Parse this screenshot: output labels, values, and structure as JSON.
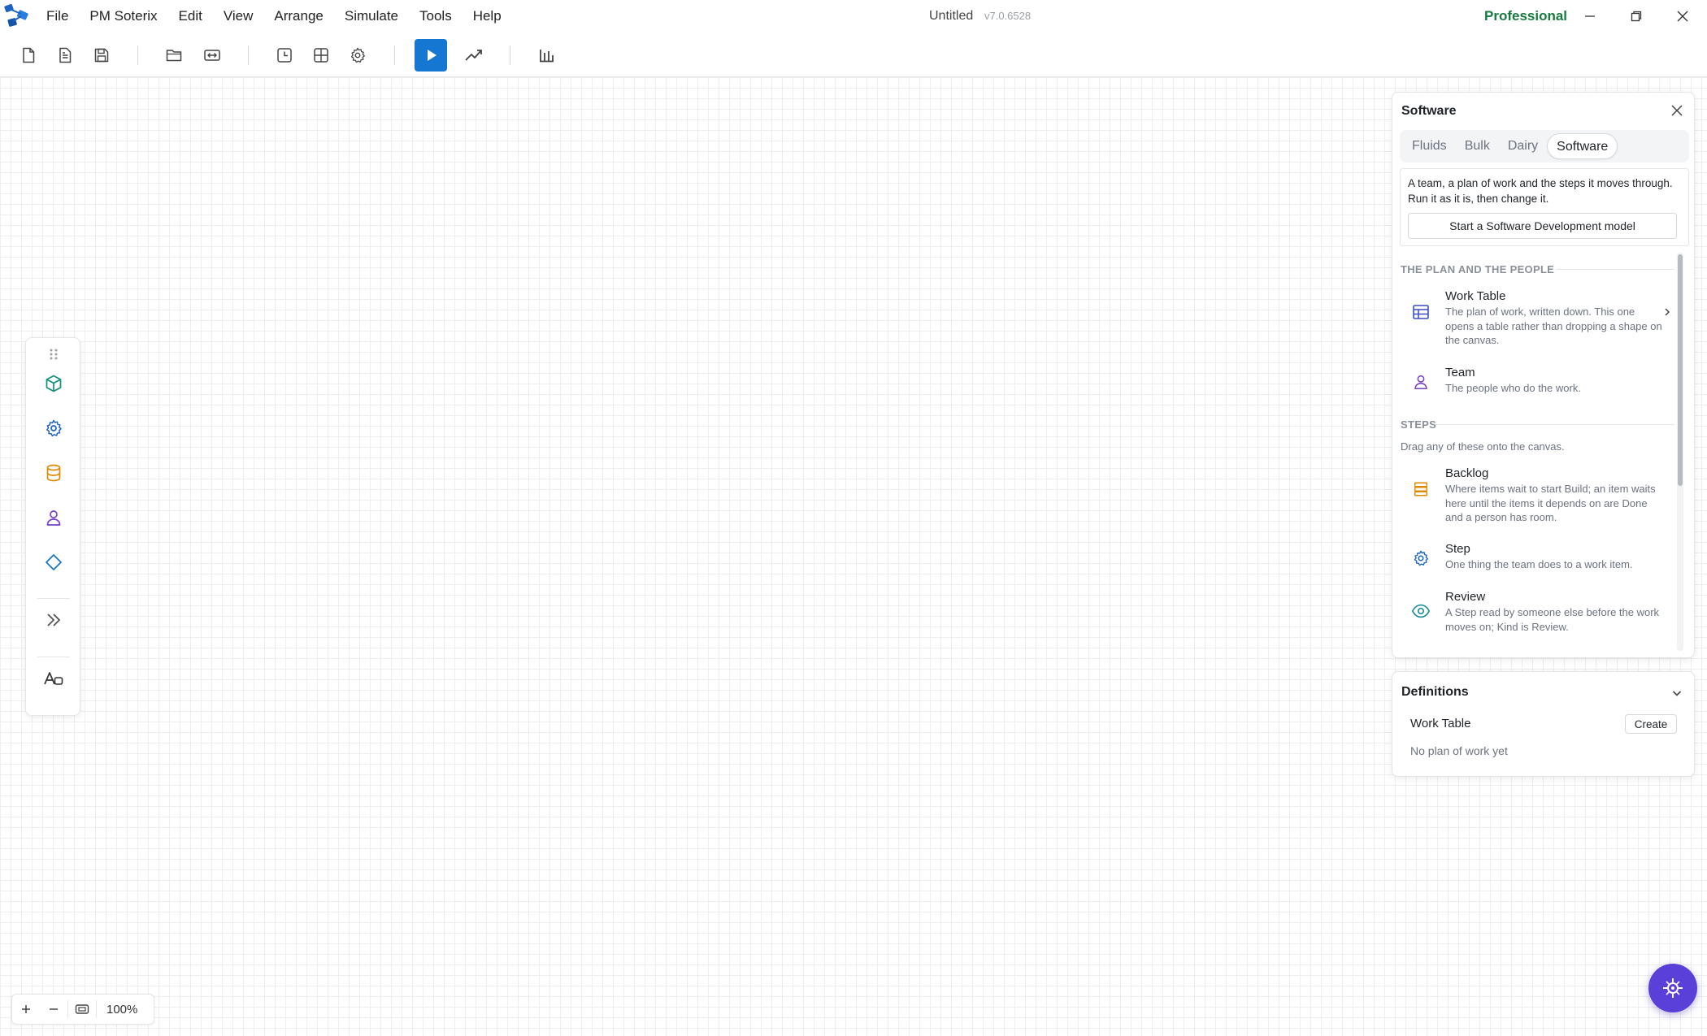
{
  "menu": {
    "items": [
      {
        "label": "File"
      },
      {
        "label": "PM Soterix"
      },
      {
        "label": "Edit"
      },
      {
        "label": "View"
      },
      {
        "label": "Arrange"
      },
      {
        "label": "Simulate"
      },
      {
        "label": "Tools"
      },
      {
        "label": "Help"
      }
    ]
  },
  "window": {
    "title": "Untitled",
    "version": "v7.0.6528",
    "edition": "Professional"
  },
  "toolbar": {
    "icons": [
      "new-file-icon",
      "document-icon",
      "save-icon",
      "open-folder-icon",
      "export-icon",
      "clock-icon",
      "grid-icon",
      "settings-icon",
      "play-icon",
      "trend-icon",
      "bar-chart-icon"
    ]
  },
  "palette": {
    "icons": [
      "drag-handle-icon",
      "cube-icon",
      "gear-icon",
      "database-icon",
      "person-icon",
      "diamond-icon",
      "chevrons-right-icon",
      "text-icon"
    ]
  },
  "zoom": {
    "level": "100%"
  },
  "library": {
    "title": "Software",
    "tabs": [
      {
        "label": "Fluids"
      },
      {
        "label": "Bulk"
      },
      {
        "label": "Dairy"
      },
      {
        "label": "Software"
      }
    ],
    "active_tab": "Software",
    "intro": "A team, a plan of work and the steps it moves through. Run it as it is, then change it.",
    "start_button": "Start a Software Development model",
    "sections": [
      {
        "heading": "THE PLAN AND THE PEOPLE",
        "items": [
          {
            "title": "Work Table",
            "desc": "The plan of work, written down. This one opens a table rather than dropping a shape on the canvas.",
            "icon": "table-icon",
            "color": "#3b4bc8"
          },
          {
            "title": "Team",
            "desc": "The people who do the work.",
            "icon": "person-icon",
            "color": "#7b3fc7"
          }
        ]
      },
      {
        "heading": "STEPS",
        "subtitle": "Drag any of these onto the canvas.",
        "items": [
          {
            "title": "Backlog",
            "desc": "Where items wait to start Build; an item waits here until the items it depends on are Done and a person has room.",
            "icon": "stack-icon",
            "color": "#e08a00"
          },
          {
            "title": "Step",
            "desc": "One thing the team does to a work item.",
            "icon": "gear-icon",
            "color": "#1d63c4"
          },
          {
            "title": "Review",
            "desc": "A Step read by someone else before the work moves on; Kind is Review.",
            "icon": "eye-icon",
            "color": "#118a95"
          }
        ]
      }
    ]
  },
  "definitions": {
    "title": "Definitions",
    "label": "Work Table",
    "button": "Create",
    "empty": "No plan of work yet"
  },
  "colors": {
    "accent": "#1677d2",
    "edition": "#167b3f",
    "assistant": "#5b3fd9"
  }
}
